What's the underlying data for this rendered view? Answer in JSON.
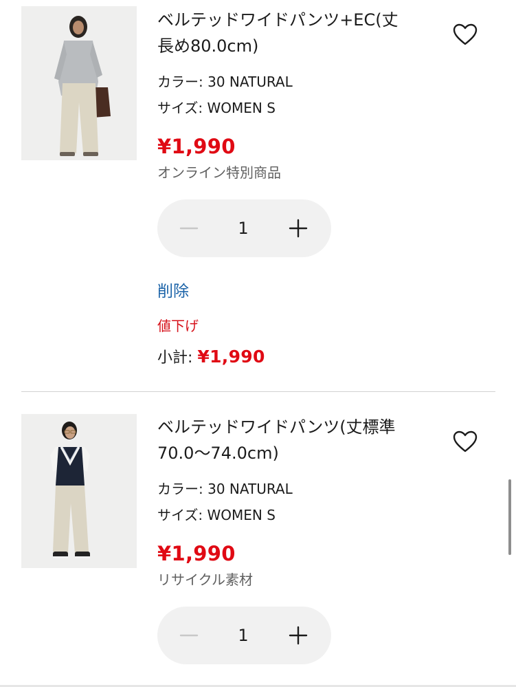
{
  "cart": {
    "items": [
      {
        "name": "ベルテッドワイドパンツ+EC(丈長め80.0cm)",
        "name_line1": "ベルテッドワイドパンツ+EC(丈",
        "name_line2": "長め80.0cm)",
        "color": "カラー: 30 NATURAL",
        "size": "サイズ: WOMEN S",
        "price": "¥1,990",
        "tag": "オンライン特別商品",
        "quantity": "1",
        "delete_label": "削除",
        "price_down_label": "値下げ",
        "subtotal_label": "小計: ",
        "subtotal_value": "¥1,990",
        "favorite_icon": "heart-outline-icon"
      },
      {
        "name": "ベルテッドワイドパンツ(丈標準70.0〜74.0cm)",
        "name_line1": "ベルテッドワイドパンツ(丈標準",
        "name_line2": "70.0〜74.0cm)",
        "color": "カラー: 30 NATURAL",
        "size": "サイズ: WOMEN S",
        "price": "¥1,990",
        "tag": "リサイクル素材",
        "quantity": "1",
        "favorite_icon": "heart-outline-icon"
      }
    ]
  },
  "icons": {
    "minus": "minus-icon",
    "plus": "plus-icon"
  },
  "colors": {
    "price_red": "#e00a14",
    "link_blue": "#1b63a8",
    "stepper_bg": "#f1f1f1",
    "muted_text": "#5f5f5f"
  }
}
